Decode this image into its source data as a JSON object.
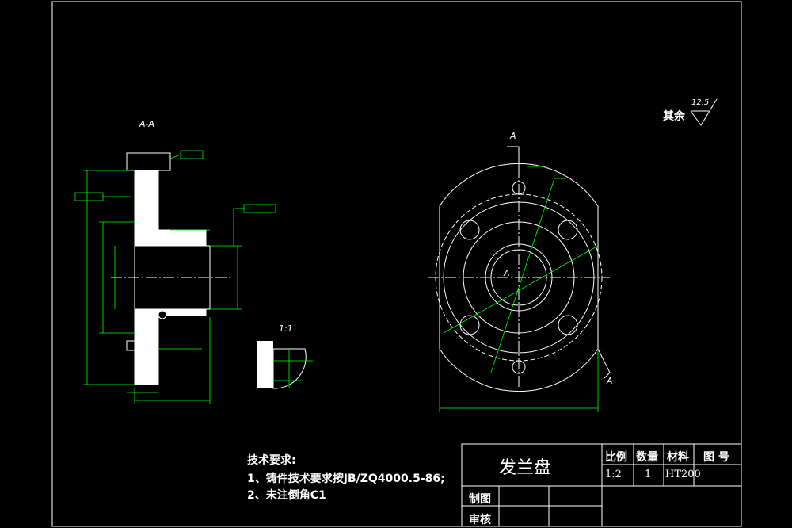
{
  "drawing": {
    "section_label": "A-A",
    "detail_label": "1:1",
    "cut_label": "A",
    "center_label": "A",
    "roughness": {
      "label": "其余",
      "value": "12.5"
    }
  },
  "notes": {
    "title": "技术要求:",
    "items": [
      "1、铸件技术要求按JB/ZQ4000.5-86;",
      "2、未注倒角C1"
    ]
  },
  "title_block": {
    "part_name": "发兰盘",
    "headers": {
      "scale": "比例",
      "quantity": "数量",
      "material": "材料",
      "drawing_no": "图 号"
    },
    "values": {
      "scale": "1:2",
      "quantity": "1",
      "material": "HT200"
    },
    "roles": {
      "drawn": "制图",
      "checked": "审核"
    }
  },
  "colors": {
    "background": "#000000",
    "frame": "#ffffff",
    "dimension": "#00ff00"
  }
}
